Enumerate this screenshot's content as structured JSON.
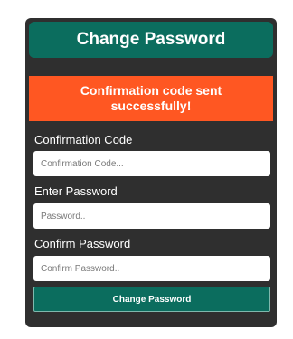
{
  "header": {
    "title": "Change Password"
  },
  "alert": {
    "message": "Confirmation code sent successfully!"
  },
  "form": {
    "code": {
      "label": "Confirmation Code",
      "placeholder": "Confirmation Code...",
      "value": ""
    },
    "password": {
      "label": "Enter Password",
      "placeholder": "Password..",
      "value": ""
    },
    "confirm": {
      "label": "Confirm Password",
      "placeholder": "Confirm Password..",
      "value": ""
    },
    "submit_label": "Change Password"
  },
  "colors": {
    "card_bg": "#2f2f2f",
    "primary": "#0b6d5e",
    "alert": "#ff5722"
  }
}
